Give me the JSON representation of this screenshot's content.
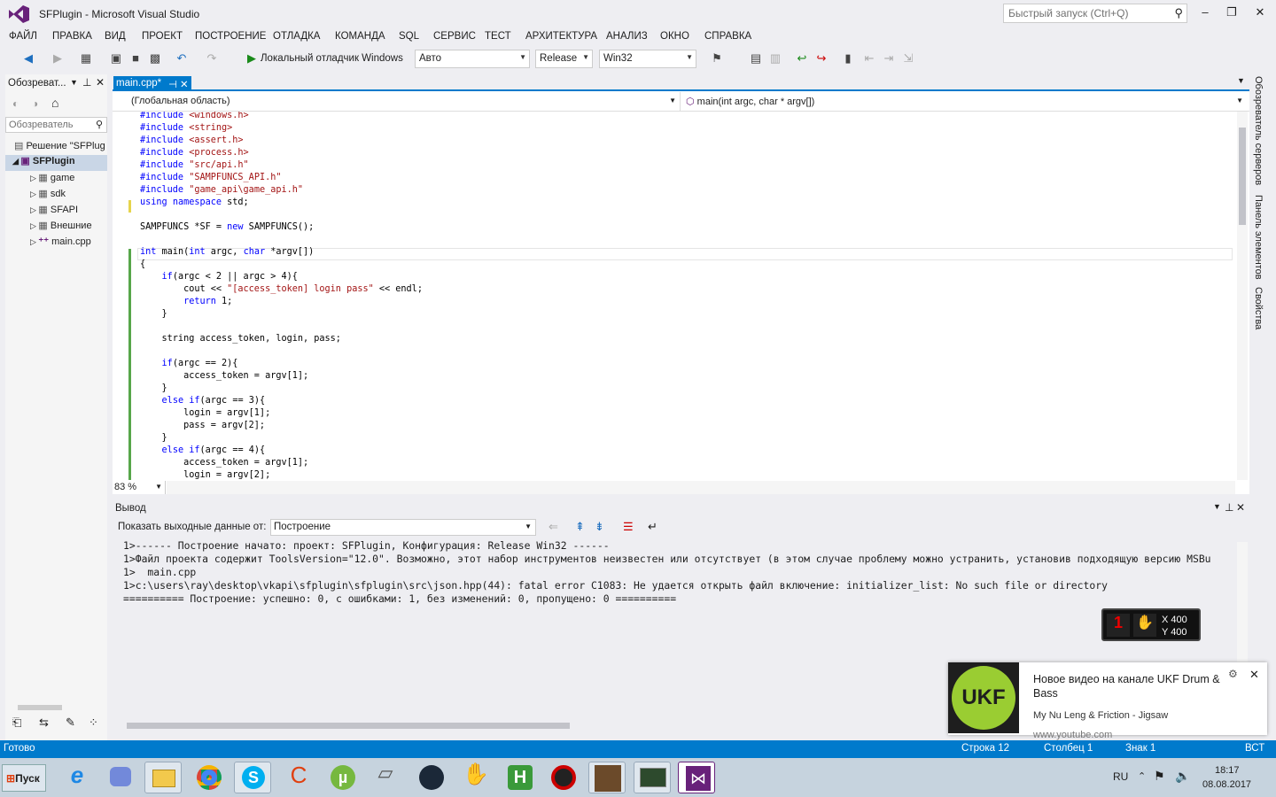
{
  "window": {
    "title": "SFPlugin - Microsoft Visual Studio",
    "quick_launch_placeholder": "Быстрый запуск (Ctrl+Q)"
  },
  "menu": [
    "ФАЙЛ",
    "ПРАВКА",
    "ВИД",
    "ПРОЕКТ",
    "ПОСТРОЕНИЕ",
    "ОТЛАДКА",
    "КОМАНДА",
    "SQL",
    "СЕРВИС",
    "ТЕСТ",
    "АРХИТЕКТУРА",
    "АНАЛИЗ",
    "ОКНО",
    "СПРАВКА"
  ],
  "toolbar": {
    "debugger_label": "Локальный отладчик Windows",
    "config_auto": "Авто",
    "config_release": "Release",
    "platform": "Win32"
  },
  "left_panel": {
    "title": "Обозреват...",
    "search_placeholder": "Обозреватель",
    "tree": [
      "Решение \"SFPlug",
      "SFPlugin",
      "game",
      "sdk",
      "SFAPI",
      "Внешние",
      "main.cpp"
    ]
  },
  "editor": {
    "tab_label": "main.cpp*",
    "scope": "(Глобальная область)",
    "function": "main(int argc, char * argv[])",
    "zoom": "83 %",
    "lines": [
      {
        "t": "#include <windows.h>",
        "k": "pp"
      },
      {
        "t": "#include <string>",
        "k": "pp"
      },
      {
        "t": "#include <assert.h>",
        "k": "pp"
      },
      {
        "t": "#include <process.h>",
        "k": "pp"
      },
      {
        "t": "#include \"src/api.h\"",
        "k": "pp"
      },
      {
        "t": "#include \"SAMPFUNCS_API.h\"",
        "k": "pp"
      },
      {
        "t": "#include \"game_api\\game_api.h\"",
        "k": "pp"
      },
      {
        "t": "using namespace std;",
        "k": "kw"
      },
      {
        "t": "",
        "k": ""
      },
      {
        "t": "SAMPFUNCS *SF = new SAMPFUNCS();",
        "k": ""
      },
      {
        "t": "",
        "k": ""
      },
      {
        "t": "int main(int argc, char *argv[])",
        "k": ""
      },
      {
        "t": "{",
        "k": ""
      },
      {
        "t": "    if(argc < 2 || argc > 4){",
        "k": ""
      },
      {
        "t": "        cout << \"[access_token] login pass\" << endl;",
        "k": ""
      },
      {
        "t": "        return 1;",
        "k": ""
      },
      {
        "t": "    }",
        "k": ""
      },
      {
        "t": "",
        "k": ""
      },
      {
        "t": "    string access_token, login, pass;",
        "k": ""
      },
      {
        "t": "",
        "k": ""
      },
      {
        "t": "    if(argc == 2){",
        "k": ""
      },
      {
        "t": "        access_token = argv[1];",
        "k": ""
      },
      {
        "t": "    }",
        "k": ""
      },
      {
        "t": "    else if(argc == 3){",
        "k": ""
      },
      {
        "t": "        login = argv[1];",
        "k": ""
      },
      {
        "t": "        pass = argv[2];",
        "k": ""
      },
      {
        "t": "    }",
        "k": ""
      },
      {
        "t": "    else if(argc == 4){",
        "k": ""
      },
      {
        "t": "        access_token = argv[1];",
        "k": ""
      },
      {
        "t": "        login = argv[2];",
        "k": ""
      }
    ]
  },
  "output": {
    "title": "Вывод",
    "show_from_label": "Показать выходные данные от:",
    "source": "Построение",
    "lines": [
      "1>------ Построение начато: проект: SFPlugin, Конфигурация: Release Win32 ------",
      "1>Файл проекта содержит ToolsVersion=\"12.0\". Возможно, этот набор инструментов неизвестен или отсутствует (в этом случае проблему можно устранить, установив подходящую версию MSBu",
      "1>  main.cpp",
      "1>c:\\users\\ray\\desktop\\vkapi\\sfplugin\\sfplugin\\src\\json.hpp(44): fatal error C1083: Не удается открыть файл включение: initializer_list: No such file or directory",
      "========== Построение: успешно: 0, с ошибками: 1, без изменений: 0, пропущено: 0 =========="
    ]
  },
  "overlay": {
    "x": "X 400",
    "y": "Y 400"
  },
  "notification": {
    "title": "Новое видео на канале UKF Drum & Bass",
    "subtitle": "My Nu Leng & Friction - Jigsaw",
    "source": "www.youtube.com",
    "logo": "UKF"
  },
  "status": {
    "ready": "Готово",
    "line": "Строка 12",
    "col": "Столбец 1",
    "char": "Знак 1",
    "mode": "ВСТ"
  },
  "right_tabs": [
    "Обозреватель серверов",
    "Панель элементов",
    "Свойства"
  ],
  "taskbar": {
    "start": "Пуск",
    "lang": "RU",
    "time": "18:17",
    "date": "08.08.2017"
  }
}
